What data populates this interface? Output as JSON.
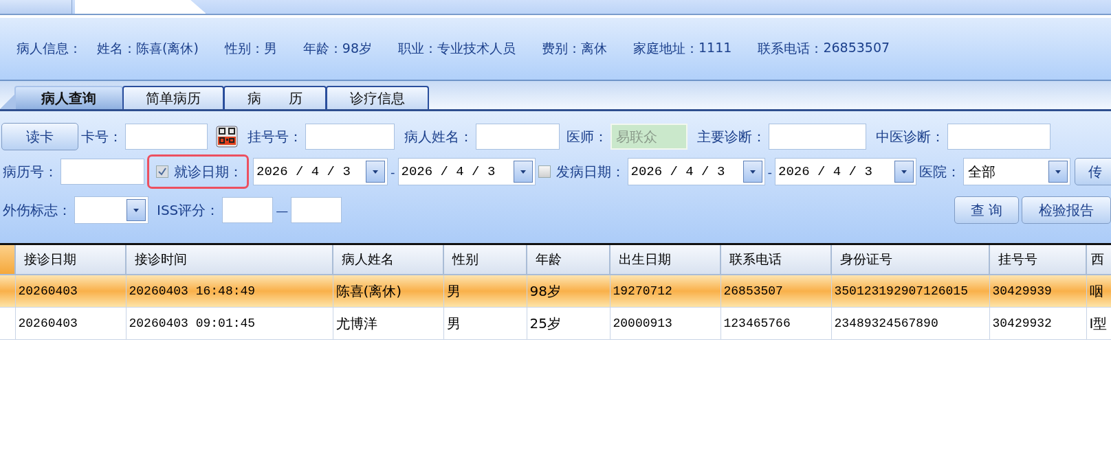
{
  "top_tabs": [
    {
      "selected": false
    },
    {
      "selected": true
    }
  ],
  "patient_info": {
    "title": "病人信息：",
    "fields": [
      {
        "label": "姓名：",
        "value": "陈喜(离休)"
      },
      {
        "label": "性别：",
        "value": "男"
      },
      {
        "label": "年龄：",
        "value": "98岁"
      },
      {
        "label": "职业：",
        "value": "专业技术人员"
      },
      {
        "label": "费别：",
        "value": "离休"
      },
      {
        "label": "家庭地址：",
        "value": "1111"
      },
      {
        "label": "联系电话：",
        "value": "26853507"
      }
    ]
  },
  "tabs": [
    {
      "label": "病人查询",
      "selected": true
    },
    {
      "label": "简单病历",
      "selected": false
    },
    {
      "label": "病　　历",
      "selected": false
    },
    {
      "label": "诊疗信息",
      "selected": false
    }
  ],
  "form_rows": [
    [
      {
        "kind": "button",
        "text": "读卡"
      },
      {
        "kind": "label",
        "text": "卡号："
      },
      {
        "kind": "input"
      },
      {
        "kind": "qr"
      },
      {
        "kind": "label",
        "text": "挂号号："
      },
      {
        "kind": "input"
      },
      {
        "kind": "label",
        "text": "病人姓名："
      },
      {
        "kind": "input"
      },
      {
        "kind": "label",
        "text": "医师："
      },
      {
        "kind": "readonly",
        "value": "易联众"
      },
      {
        "kind": "label",
        "text": "主要诊断："
      },
      {
        "kind": "input"
      },
      {
        "kind": "label",
        "text": "中医诊断："
      },
      {
        "kind": "input"
      }
    ],
    [
      {
        "kind": "label",
        "text": "病历号："
      },
      {
        "kind": "input"
      },
      {
        "kind": "checkbox",
        "text": "就诊日期：",
        "checked": true,
        "highlighted": true
      },
      {
        "kind": "date",
        "value": "2026 / 4 / 3"
      },
      {
        "kind": "dash",
        "text": "-"
      },
      {
        "kind": "date",
        "value": "2026 / 4 / 3"
      },
      {
        "kind": "checkbox",
        "text": "发病日期：",
        "checked": false,
        "highlighted": false
      },
      {
        "kind": "date",
        "value": "2026 / 4 / 3"
      },
      {
        "kind": "dash",
        "text": "-"
      },
      {
        "kind": "date",
        "value": "2026 / 4 / 3"
      },
      {
        "kind": "label",
        "text": "医院："
      },
      {
        "kind": "combo",
        "value": "全部"
      },
      {
        "kind": "button",
        "text": "传"
      }
    ],
    [
      {
        "kind": "label",
        "text": "外伤标志："
      },
      {
        "kind": "combo"
      },
      {
        "kind": "label",
        "text": "ISS评分："
      },
      {
        "kind": "input"
      },
      {
        "kind": "dash",
        "text": "—"
      },
      {
        "kind": "input"
      },
      {
        "kind": "spacer"
      },
      {
        "kind": "button",
        "text": "查 询"
      },
      {
        "kind": "button",
        "text": "检验报告"
      }
    ]
  ],
  "table": {
    "columns": [
      "接诊日期",
      "接诊时间",
      "病人姓名",
      "性别",
      "年龄",
      "出生日期",
      "联系电话",
      "身份证号",
      "挂号号",
      "西"
    ],
    "rows": [
      {
        "selected": true,
        "cells": [
          "20260403",
          "20260403 16:48:49",
          "陈喜(离休)",
          "男",
          "98岁",
          "19270712",
          "26853507",
          "350123192907126015",
          "30429939",
          "咽"
        ]
      },
      {
        "selected": false,
        "cells": [
          "20260403",
          "20260403 09:01:45",
          "尤博洋",
          "男",
          "25岁",
          "20000913",
          "123465766",
          "23489324567890",
          "30429932",
          "I型"
        ]
      }
    ]
  }
}
